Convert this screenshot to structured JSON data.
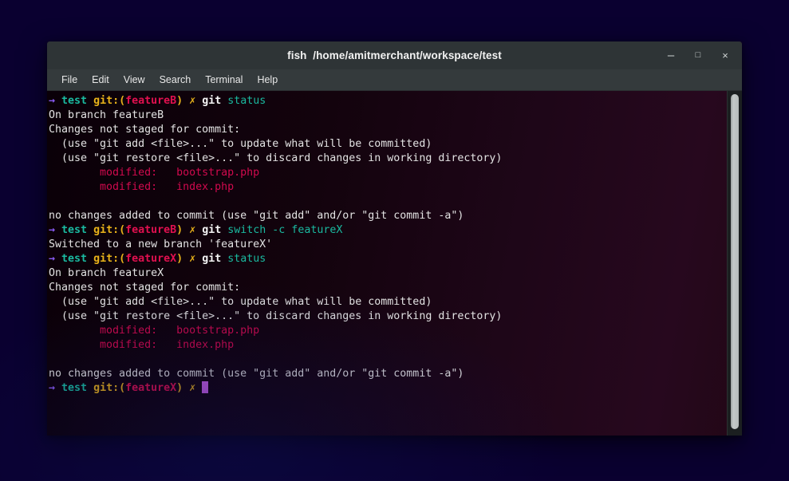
{
  "window": {
    "title": "fish  /home/amitmerchant/workspace/test",
    "controls": {
      "minimize": "–",
      "maximize": "□",
      "close": "×"
    }
  },
  "menubar": {
    "items": [
      {
        "label": "File"
      },
      {
        "label": "Edit"
      },
      {
        "label": "View"
      },
      {
        "label": "Search"
      },
      {
        "label": "Terminal"
      },
      {
        "label": "Help"
      }
    ]
  },
  "colors": {
    "titlebar_bg": "#2e3436",
    "menubar_bg": "#343a3c",
    "terminal_bg": "#13030d",
    "prompt_arrow": "#8b5cf6",
    "prompt_dir": "#1ab9a0",
    "prompt_git_label": "#e8b21a",
    "prompt_branch": "#e0104f",
    "prompt_dirty": "#e8b21a",
    "command": "#f5f5f5",
    "argument": "#1ab9a0",
    "modified": "#d10a4e",
    "default_text": "#e3e3e3",
    "cursor": "#cd61ee"
  },
  "prompt": {
    "arrow": "→",
    "dir": "test",
    "git_open": "git:(",
    "git_close": ")",
    "dirty_mark": "✗"
  },
  "terminal": {
    "lines": [
      {
        "type": "prompt",
        "branch": "featureB",
        "command": "git",
        "args": " status"
      },
      {
        "type": "output",
        "text": "On branch featureB"
      },
      {
        "type": "output",
        "text": "Changes not staged for commit:"
      },
      {
        "type": "output",
        "text": "  (use \"git add <file>...\" to update what will be committed)"
      },
      {
        "type": "output",
        "text": "  (use \"git restore <file>...\" to discard changes in working directory)"
      },
      {
        "type": "modified",
        "text": "        modified:   bootstrap.php"
      },
      {
        "type": "modified",
        "text": "        modified:   index.php"
      },
      {
        "type": "output",
        "text": ""
      },
      {
        "type": "output",
        "text": "no changes added to commit (use \"git add\" and/or \"git commit -a\")"
      },
      {
        "type": "prompt",
        "branch": "featureB",
        "command": "git",
        "args": " switch -c featureX"
      },
      {
        "type": "output",
        "text": "Switched to a new branch 'featureX'"
      },
      {
        "type": "prompt",
        "branch": "featureX",
        "command": "git",
        "args": " status"
      },
      {
        "type": "output",
        "text": "On branch featureX"
      },
      {
        "type": "output",
        "text": "Changes not staged for commit:"
      },
      {
        "type": "output",
        "text": "  (use \"git add <file>...\" to update what will be committed)"
      },
      {
        "type": "output",
        "text": "  (use \"git restore <file>...\" to discard changes in working directory)"
      },
      {
        "type": "modified",
        "text": "        modified:   bootstrap.php"
      },
      {
        "type": "modified",
        "text": "        modified:   index.php"
      },
      {
        "type": "output",
        "text": ""
      },
      {
        "type": "output",
        "text": "no changes added to commit (use \"git add\" and/or \"git commit -a\")"
      },
      {
        "type": "prompt",
        "branch": "featureX",
        "command": "",
        "args": "",
        "cursor": true
      }
    ]
  },
  "scrollbar": {
    "thumb_position": "top",
    "thumb_fraction": 0.97
  }
}
